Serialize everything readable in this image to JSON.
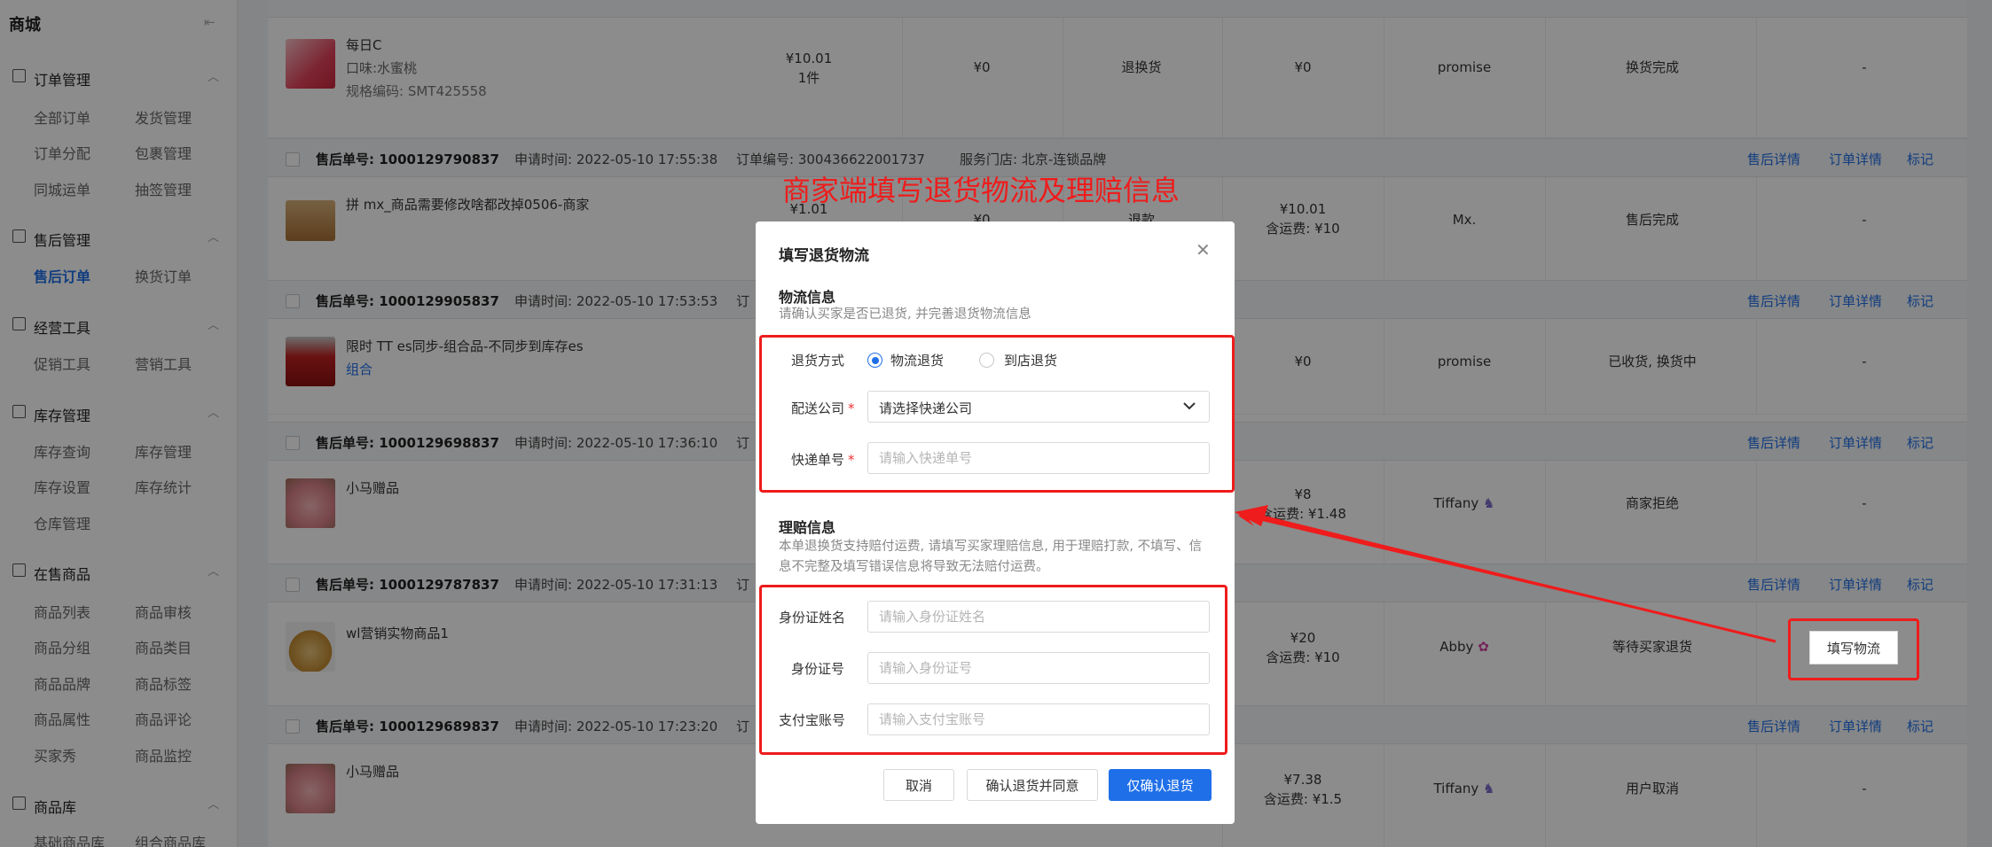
{
  "sidebar": {
    "title": "商城",
    "groups": [
      {
        "label": "订单管理",
        "items": [
          "全部订单",
          "发货管理",
          "订单分配",
          "包裹管理",
          "同城运单",
          "抽签管理"
        ]
      },
      {
        "label": "售后管理",
        "items": [
          "售后订单",
          "换货订单"
        ],
        "active": "售后订单"
      },
      {
        "label": "经营工具",
        "items": [
          "促销工具",
          "营销工具"
        ]
      },
      {
        "label": "库存管理",
        "items": [
          "库存查询",
          "库存管理",
          "库存设置",
          "库存统计",
          "仓库管理"
        ]
      },
      {
        "label": "在售商品",
        "items": [
          "商品列表",
          "商品审核",
          "商品分组",
          "商品类目",
          "商品品牌",
          "商品标签",
          "商品属性",
          "商品评论",
          "买家秀",
          "商品监控"
        ]
      },
      {
        "label": "商品库",
        "items": [
          "基础商品库",
          "组合商品库"
        ]
      }
    ]
  },
  "orders": [
    {
      "sno": "售后单号: 1000129790837",
      "apply": "申请时间: 2022-05-10 17:55:38",
      "oid": "订单编号: 300436622001737",
      "store": "服务门店: 北京-连锁品牌",
      "links": [
        "售后详情",
        "订单详情",
        "标记"
      ]
    },
    {
      "sno": "售后单号: 1000129905837",
      "apply": "申请时间: 2022-05-10 17:53:53",
      "oid": "订",
      "store": "",
      "links": [
        "售后详情",
        "订单详情",
        "标记"
      ]
    },
    {
      "sno": "售后单号: 1000129698837",
      "apply": "申请时间: 2022-05-10 17:36:10",
      "oid": "订",
      "store": "",
      "links": [
        "售后详情",
        "订单详情",
        "标记"
      ]
    },
    {
      "sno": "售后单号: 1000129787837",
      "apply": "申请时间: 2022-05-10 17:31:13",
      "oid": "订",
      "store": "",
      "links": [
        "售后详情",
        "订单详情",
        "标记"
      ]
    },
    {
      "sno": "售后单号: 1000129689837",
      "apply": "申请时间: 2022-05-10 17:23:20",
      "oid": "订",
      "store": "",
      "links": [
        "售后详情",
        "订单详情",
        "标记"
      ]
    }
  ],
  "rows": [
    {
      "name": "每日C",
      "sub": "口味:水蜜桃",
      "code": "规格编码: SMT425558",
      "price": "¥10.01",
      "qty": "1件",
      "refund": "¥0",
      "type": "退换货",
      "fee": "¥0",
      "fee2": "",
      "user": "promise",
      "status": "换货完成",
      "op": "-"
    },
    {
      "name": "拼   mx_商品需要修改啥都改掉0506-商家",
      "sub": "",
      "code": "",
      "price": "¥1.01",
      "qty": "",
      "refund": "¥0",
      "type": "退款",
      "fee": "¥10.01",
      "fee2": "含运费: ¥10",
      "user": "Mx.",
      "status": "售后完成",
      "op": "-"
    },
    {
      "name": "限时   TT es同步-组合品-不同步到库存es",
      "sub": "组合",
      "code": "",
      "price": "",
      "qty": "",
      "refund": "",
      "type": "",
      "fee": "¥0",
      "fee2": "",
      "user": "promise",
      "status": "已收货, 换货中",
      "op": "-"
    },
    {
      "name": "小马赠品",
      "sub": "",
      "code": "",
      "price": "",
      "qty": "",
      "refund": "",
      "type": "",
      "fee": "¥8",
      "fee2": "含运费: ¥1.48",
      "user": "Tiffany",
      "status": "商家拒绝",
      "op": "-"
    },
    {
      "name": "wl营销实物商品1",
      "sub": "",
      "code": "",
      "price": "",
      "qty": "",
      "refund": "",
      "type": "",
      "fee": "¥20",
      "fee2": "含运费: ¥10",
      "user": "Abby",
      "status": "等待买家退货",
      "op": "填写物流"
    },
    {
      "name": "小马赠品",
      "sub": "",
      "code": "",
      "price": "",
      "qty": "",
      "refund": "",
      "type": "",
      "fee": "¥7.38",
      "fee2": "含运费: ¥1.5",
      "user": "Tiffany",
      "status": "用户取消",
      "op": "-"
    }
  ],
  "annotation": "商家端填写退货物流及理赔信息",
  "modal": {
    "title": "填写退货物流",
    "logistics": {
      "title": "物流信息",
      "desc": "请确认买家是否已退货, 并完善退货物流信息",
      "return_method_label": "退货方式",
      "options": [
        "物流退货",
        "到店退货"
      ],
      "selected": "物流退货",
      "company_label": "配送公司",
      "company_value": "请选择快递公司",
      "tracking_label": "快递单号",
      "tracking_placeholder": "请输入快递单号"
    },
    "claim": {
      "title": "理赔信息",
      "desc": "本单退换货支持赔付运费, 请填写买家理赔信息, 用于理赔打款, 不填写、信息不完整及填写错误信息将导致无法赔付运费。",
      "name_label": "身份证姓名",
      "name_placeholder": "请输入身份证姓名",
      "id_label": "身份证号",
      "id_placeholder": "请输入身份证号",
      "alipay_label": "支付宝账号",
      "alipay_placeholder": "请输入支付宝账号"
    },
    "buttons": {
      "cancel": "取消",
      "confirm_agree": "确认退货并同意",
      "confirm_only": "仅确认退货"
    }
  },
  "colors": {
    "primary": "#1f6fe8",
    "annotation_red": "#ee1c1c"
  }
}
